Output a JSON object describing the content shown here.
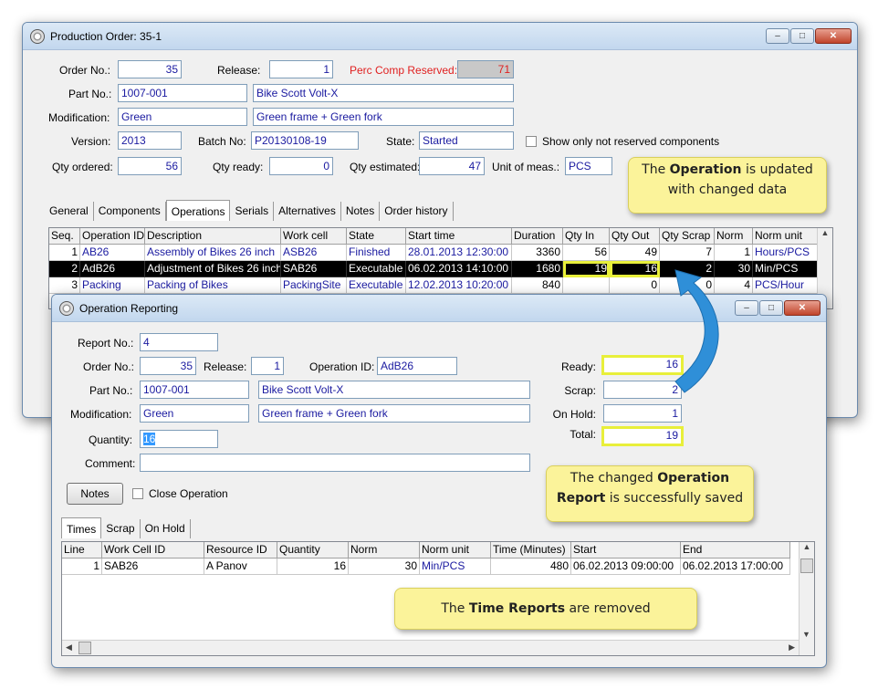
{
  "po": {
    "title": "Production Order: 35-1",
    "order_no_label": "Order No.:",
    "order_no": "35",
    "release_label": "Release:",
    "release": "1",
    "perc_label": "Perc Comp Reserved:",
    "perc": "71",
    "part_label": "Part No.:",
    "part_no": "1007-001",
    "part_desc": "Bike Scott Volt-X",
    "mod_label": "Modification:",
    "mod": "Green",
    "mod_desc": "Green frame + Green fork",
    "version_label": "Version:",
    "version": "2013",
    "batch_label": "Batch No:",
    "batch": "P20130108-19",
    "state_label": "State:",
    "state": "Started",
    "show_label": "Show only not reserved components",
    "qty_ordered_label": "Qty ordered:",
    "qty_ordered": "56",
    "qty_ready_label": "Qty ready:",
    "qty_ready": "0",
    "qty_est_label": "Qty estimated:",
    "qty_est": "47",
    "uom_label": "Unit of meas.:",
    "uom": "PCS",
    "tabs": [
      "General",
      "Components",
      "Operations",
      "Serials",
      "Alternatives",
      "Notes",
      "Order history"
    ],
    "columns": [
      "Seq.",
      "Operation ID",
      "Description",
      "Work cell",
      "State",
      "Start time",
      "Duration",
      "Qty In",
      "Qty Out",
      "Qty Scrap",
      "Norm",
      "Norm unit"
    ],
    "rows": [
      [
        "1",
        "AB26",
        "Assembly of Bikes 26 inch",
        "ASB26",
        "Finished",
        "28.01.2013 12:30:00",
        "3360",
        "56",
        "49",
        "7",
        "1",
        "Hours/PCS"
      ],
      [
        "2",
        "AdB26",
        "Adjustment of Bikes 26 inch",
        "SAB26",
        "Executable",
        "06.02.2013 14:10:00",
        "1680",
        "19",
        "16",
        "2",
        "30",
        "Min/PCS"
      ],
      [
        "3",
        "Packing",
        "Packing of Bikes",
        "PackingSite",
        "Executable",
        "12.02.2013 10:20:00",
        "840",
        "",
        "0",
        "0",
        "4",
        "PCS/Hour"
      ]
    ]
  },
  "or": {
    "title": "Operation Reporting",
    "report_label": "Report No.:",
    "report_no": "4",
    "order_label": "Order No.:",
    "order_no": "35",
    "release_label": "Release:",
    "release": "1",
    "opid_label": "Operation ID:",
    "opid": "AdB26",
    "part_label": "Part No.:",
    "part_no": "1007-001",
    "part_desc": "Bike Scott Volt-X",
    "mod_label": "Modification:",
    "mod": "Green",
    "mod_desc": "Green frame + Green fork",
    "qty_label": "Quantity:",
    "qty": "16",
    "comment_label": "Comment:",
    "ready_label": "Ready:",
    "ready": "16",
    "scrap_label": "Scrap:",
    "scrap": "2",
    "onhold_label": "On Hold:",
    "onhold": "1",
    "total_label": "Total:",
    "total": "19",
    "notes_btn": "Notes",
    "close_op_label": "Close Operation",
    "tabs": [
      "Times",
      "Scrap",
      "On Hold"
    ],
    "columns": [
      "Line",
      "Work Cell ID",
      "Resource ID",
      "Quantity",
      "Norm",
      "Norm unit",
      "Time (Minutes)",
      "Start",
      "End"
    ],
    "rows": [
      [
        "1",
        "SAB26",
        "A Panov",
        "16",
        "30",
        "Min/PCS",
        "480",
        "06.02.2013 09:00:00",
        "06.02.2013 17:00:00"
      ]
    ]
  },
  "callouts": {
    "c1_pre": "The ",
    "c1_bold": "Operation",
    "c1_post": " is updated",
    "c1_line2": "with changed data",
    "c2_pre": "The changed ",
    "c2_bold": "Operation",
    "c2_bold2": "Report",
    "c2_post": " is successfully saved",
    "c3_pre": "The ",
    "c3_bold": "Time Reports",
    "c3_post": " are removed"
  },
  "colors": {
    "highlight": "#e8ef3a",
    "callout": "#fbf39a",
    "arrow": "#2f8fd8",
    "field_text": "#1a1aa0"
  }
}
